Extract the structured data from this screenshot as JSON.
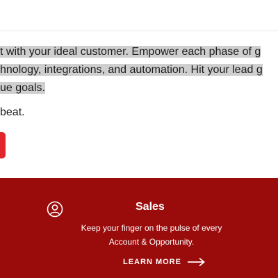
{
  "intro": {
    "line1": "t with your ideal customer. Empower each phase of g",
    "line2": "hnology, integrations, and automation. Hit your lead g",
    "line3": "ue goals."
  },
  "beat_text": "beat.",
  "colors": {
    "band": "#9a0b0b",
    "button_red": "#e0262a",
    "highlight": "#cfcfcf"
  },
  "sales_card": {
    "title": "Sales",
    "description_line1": "Keep your finger on the pulse of every",
    "description_line2": "Account & Opportunity.",
    "cta_label": "LEARN MORE",
    "icon": "user-circle-icon",
    "cta_icon": "arrow-right-icon"
  }
}
